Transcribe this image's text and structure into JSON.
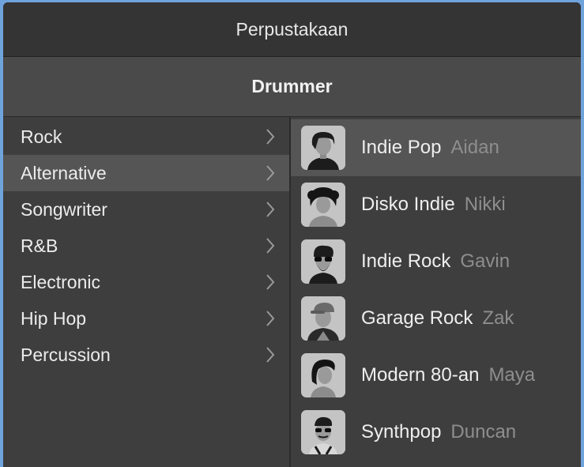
{
  "header": {
    "title": "Perpustakaan"
  },
  "section": {
    "title": "Drummer"
  },
  "genres": [
    {
      "label": "Rock"
    },
    {
      "label": "Alternative"
    },
    {
      "label": "Songwriter"
    },
    {
      "label": "R&B"
    },
    {
      "label": "Electronic"
    },
    {
      "label": "Hip Hop"
    },
    {
      "label": "Percussion"
    }
  ],
  "selected_genre": "Alternative",
  "drummers": [
    {
      "style": "Indie Pop",
      "name": "Aidan",
      "avatar_icon": "drummer-aidan-icon"
    },
    {
      "style": "Disko Indie",
      "name": "Nikki",
      "avatar_icon": "drummer-nikki-icon"
    },
    {
      "style": "Indie Rock",
      "name": "Gavin",
      "avatar_icon": "drummer-gavin-icon"
    },
    {
      "style": "Garage Rock",
      "name": "Zak",
      "avatar_icon": "drummer-zak-icon"
    },
    {
      "style": "Modern 80-an",
      "name": "Maya",
      "avatar_icon": "drummer-maya-icon"
    },
    {
      "style": "Synthpop",
      "name": "Duncan",
      "avatar_icon": "drummer-duncan-icon"
    }
  ],
  "selected_drummer": "Aidan",
  "colors": {
    "window_bg": "#3d3d3d",
    "selected_row": "#555555",
    "text_primary": "#eeeeee",
    "text_secondary": "#8e8e8e",
    "desktop_bg": "#6fa3dc"
  }
}
